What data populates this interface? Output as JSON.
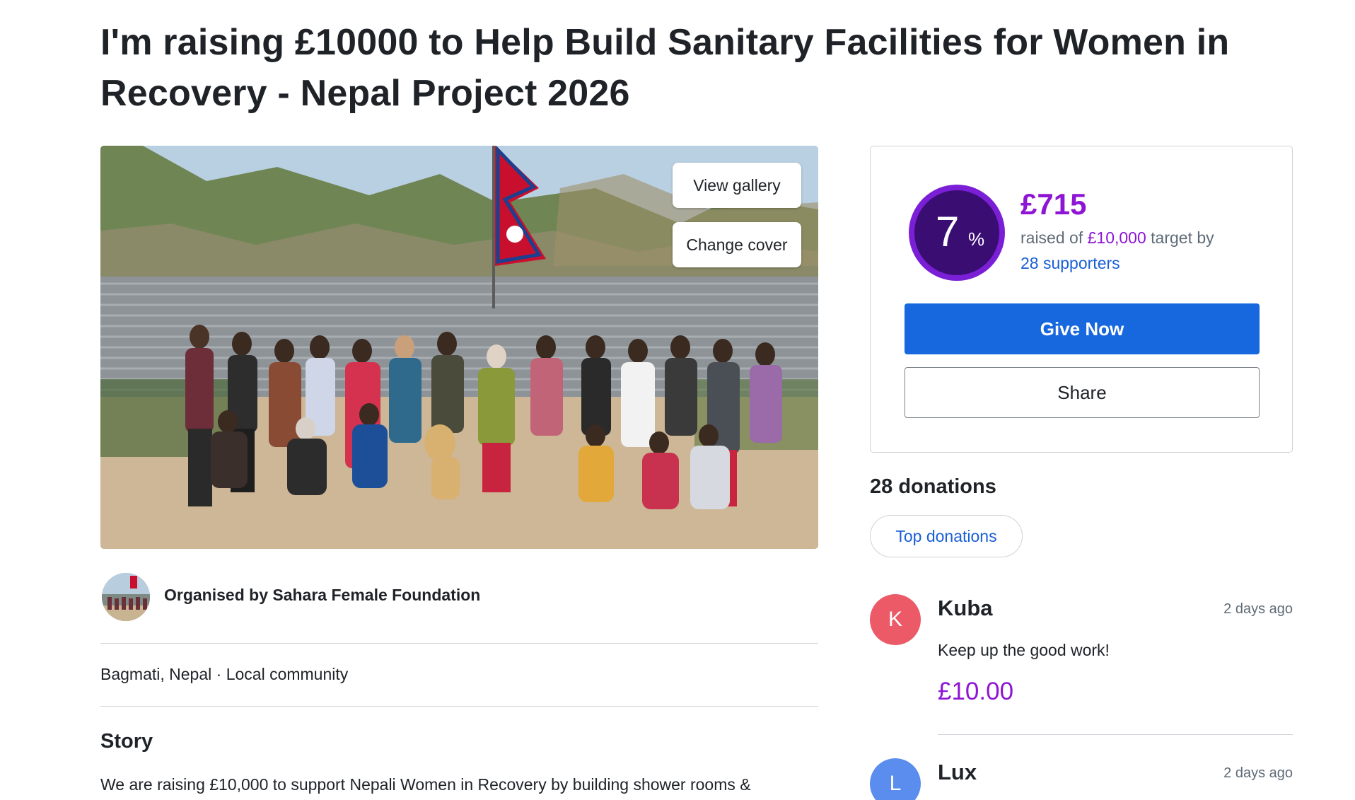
{
  "fundraiser": {
    "title": "I'm raising £10000 to Help Build Sanitary Facilities for Women in Recovery - Nepal Project 2026"
  },
  "cover": {
    "view_gallery_label": "View gallery",
    "change_cover_label": "Change cover"
  },
  "organiser": {
    "text": "Organised by Sahara Female Foundation"
  },
  "meta": {
    "location_line": "Bagmati, Nepal · Local community"
  },
  "story": {
    "heading": "Story",
    "text": "We are raising £10,000 to support Nepali Women in Recovery by building shower rooms &"
  },
  "progress": {
    "percent_number": "7",
    "percent_sign": "%",
    "percent_value": 7,
    "raised_amount": "£715",
    "raised_prefix": "raised of",
    "target_amount": "£10,000",
    "target_suffix": "target by",
    "supporters_label": "28 supporters",
    "accent_color": "#8e15d4",
    "ring_inner_color": "#3a0d73"
  },
  "actions": {
    "give_now_label": "Give Now",
    "share_label": "Share",
    "primary_color": "#1767de"
  },
  "donations": {
    "heading": "28 donations",
    "filter_label": "Top donations",
    "items": [
      {
        "initial": "K",
        "name": "Kuba",
        "time": "2 days ago",
        "message": "Keep up the good work!",
        "amount": "£10.00",
        "avatar_color": "#ec5a68"
      },
      {
        "initial": "L",
        "name": "Lux",
        "time": "2 days ago",
        "message": "",
        "amount": "",
        "avatar_color": "#5b8def"
      }
    ]
  }
}
